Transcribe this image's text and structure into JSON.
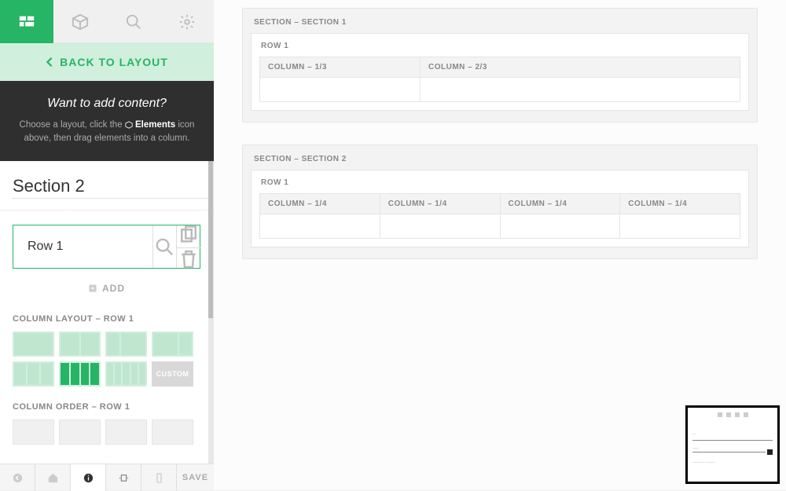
{
  "back_label": "BACK TO LAYOUT",
  "tooltip": {
    "title": "Want to add content?",
    "prefix": "Choose a layout, click the ",
    "bold": "Elements",
    "suffix": " icon above, then drag elements into a column."
  },
  "section_title": "Section 2",
  "row_title": "Row 1",
  "add_label": "ADD",
  "column_layout_label": "COLUMN LAYOUT – ROW 1",
  "column_order_label": "COLUMN ORDER – ROW 1",
  "custom_label": "CUSTOM",
  "save_label": "SAVE",
  "canvas": {
    "sections": [
      {
        "label": "SECTION – SECTION 1",
        "rows": [
          {
            "label": "ROW 1",
            "columns": [
              {
                "label": "COLUMN – 1/3",
                "flex": 1
              },
              {
                "label": "COLUMN – 2/3",
                "flex": 2
              }
            ]
          }
        ]
      },
      {
        "label": "SECTION – SECTION 2",
        "rows": [
          {
            "label": "ROW 1",
            "columns": [
              {
                "label": "COLUMN – 1/4",
                "flex": 1
              },
              {
                "label": "COLUMN – 1/4",
                "flex": 1
              },
              {
                "label": "COLUMN – 1/4",
                "flex": 1
              },
              {
                "label": "COLUMN – 1/4",
                "flex": 1
              }
            ]
          }
        ]
      }
    ]
  },
  "layout_options": [
    {
      "cols": 1,
      "active": false
    },
    {
      "cols": 2,
      "active": false
    },
    {
      "cols": 2,
      "ratio": "1-2",
      "active": false
    },
    {
      "cols": 2,
      "ratio": "2-1",
      "active": false
    },
    {
      "cols": 3,
      "active": false
    },
    {
      "cols": 4,
      "active": true
    },
    {
      "cols": 5,
      "active": false
    },
    {
      "custom": true
    }
  ]
}
